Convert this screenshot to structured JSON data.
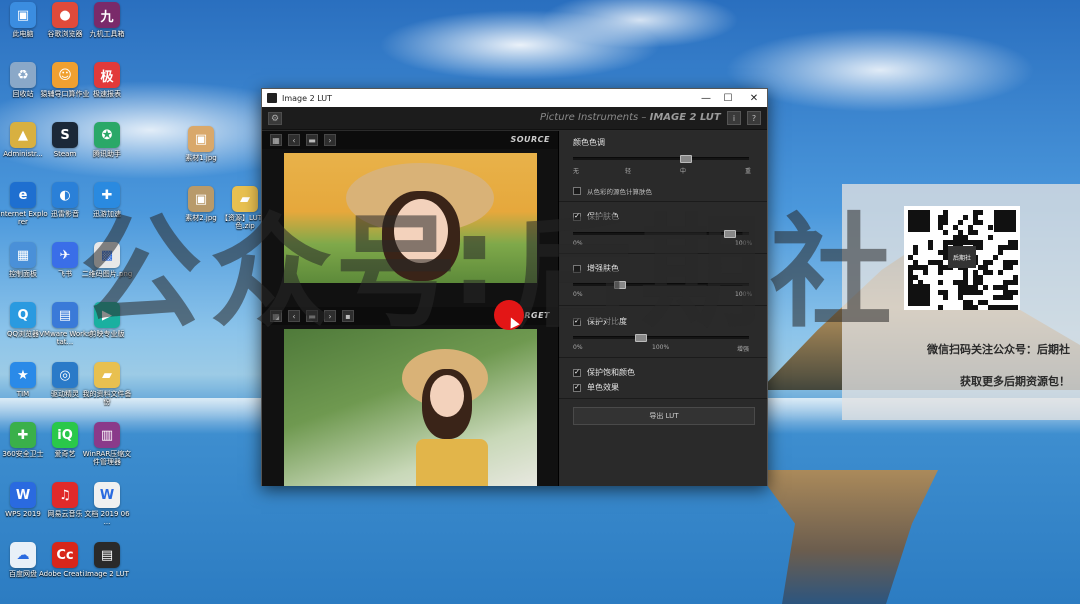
{
  "desktop_icons": [
    {
      "label": "此电脑",
      "color": "#3b8de0",
      "glyph": "▣"
    },
    {
      "label": "谷歌浏览器",
      "color": "#e04a3a",
      "glyph": "●"
    },
    {
      "label": "九机工具箱",
      "color": "#7a2a6a",
      "glyph": "九"
    },
    {
      "label": "回收站",
      "color": "#8aa8c8",
      "glyph": "♻"
    },
    {
      "label": "猿辅导口算作业",
      "color": "#f0a030",
      "glyph": "☺"
    },
    {
      "label": "极速报表",
      "color": "#e23a3a",
      "glyph": "极"
    },
    {
      "label": "Administr...",
      "color": "#d8b040",
      "glyph": "▲"
    },
    {
      "label": "Steam",
      "color": "#1b2838",
      "glyph": "S"
    },
    {
      "label": "腾讯助手",
      "color": "#2aa868",
      "glyph": "✪"
    },
    {
      "label": "Internet Explorer",
      "color": "#1e6fd0",
      "glyph": "e"
    },
    {
      "label": "迅雷影音",
      "color": "#2a80d8",
      "glyph": "◐"
    },
    {
      "label": "迅游加速",
      "color": "#2a8ae0",
      "glyph": "✚"
    },
    {
      "label": "控制面板",
      "color": "#4a90d8",
      "glyph": "▦"
    },
    {
      "label": "飞书",
      "color": "#3a6ee8",
      "glyph": "✈"
    },
    {
      "label": "二维码图片.png",
      "color": "#e8e8e8",
      "glyph": "▩"
    },
    {
      "label": "QQ浏览器",
      "color": "#2a9ae0",
      "glyph": "Q"
    },
    {
      "label": "VMware Workstat...",
      "color": "#3a7ad8",
      "glyph": "▤"
    },
    {
      "label": "剪映专业版",
      "color": "#1ab0a0",
      "glyph": "▶"
    },
    {
      "label": "TIM",
      "color": "#2a8ae8",
      "glyph": "★"
    },
    {
      "label": "驱动精灵",
      "color": "#2a7ac8",
      "glyph": "◎"
    },
    {
      "label": "我的资料文件备份",
      "color": "#e8c050",
      "glyph": "▰"
    },
    {
      "label": "360安全卫士",
      "color": "#3ab04a",
      "glyph": "✚"
    },
    {
      "label": "爱奇艺",
      "color": "#2ac84a",
      "glyph": "iQ"
    },
    {
      "label": "WinRAR压缩文件管理器",
      "color": "#8a3a8a",
      "glyph": "▥"
    },
    {
      "label": "WPS 2019",
      "color": "#2a6ae0",
      "glyph": "W"
    },
    {
      "label": "网易云音乐",
      "color": "#e02a2a",
      "glyph": "♫"
    },
    {
      "label": "文档 2019 06 ...",
      "color": "#f0f0f0",
      "glyph": "W"
    },
    {
      "label": "百度网盘",
      "color": "#e8f0f8",
      "glyph": "☁"
    },
    {
      "label": "Adobe Creati...",
      "color": "#d8261a",
      "glyph": "Cc"
    },
    {
      "label": "Image 2 LUT",
      "color": "#2a2a2a",
      "glyph": "▤"
    }
  ],
  "mid_desktop_icons": [
    {
      "label": "素材1.jpg"
    },
    {
      "label": "素材2.jpg"
    },
    {
      "label": "【资源】LUT调色.zip"
    }
  ],
  "watermark": {
    "chars": [
      "公",
      "众",
      "号",
      ":",
      "后",
      "期",
      "社"
    ]
  },
  "qr_panel": {
    "center_label": "后期社",
    "line1": "微信扫码关注公众号：后期社",
    "line2": "获取更多后期资源包！"
  },
  "window": {
    "title": "Image 2 LUT",
    "minimize": "—",
    "maximize": "☐",
    "close": "✕",
    "brand_left": "Picture Instruments",
    "brand_right": "IMAGE 2 LUT",
    "info_btn": "i",
    "help_btn": "?"
  },
  "source_pane": {
    "label": "SOURCE"
  },
  "target_pane": {
    "label": "TARGET"
  },
  "controls": {
    "color_tone": {
      "title": "颜色色调",
      "ticks": [
        "无",
        "轻",
        "中",
        "重"
      ],
      "value_position": 0.65
    },
    "skin_from_image": {
      "label": "从色彩的源色计算肤色",
      "checked": false
    },
    "protect_skin": {
      "label": "保护肤色",
      "checked": true,
      "min": "0%",
      "max": "100%",
      "value": 0.92
    },
    "enhance_skin": {
      "label": "增强肤色",
      "checked": false,
      "min": "0%",
      "max": "100%",
      "value": 0.25
    },
    "protect_contrast": {
      "label": "保护对比度",
      "checked": true,
      "min": "0%",
      "mid": "100%",
      "max": "增强",
      "value": 0.38
    },
    "protect_saturation": {
      "label": "保护饱和颜色",
      "checked": true
    },
    "mono": {
      "label": "单色效果",
      "checked": true
    },
    "export": {
      "label": "导出 LUT"
    }
  }
}
